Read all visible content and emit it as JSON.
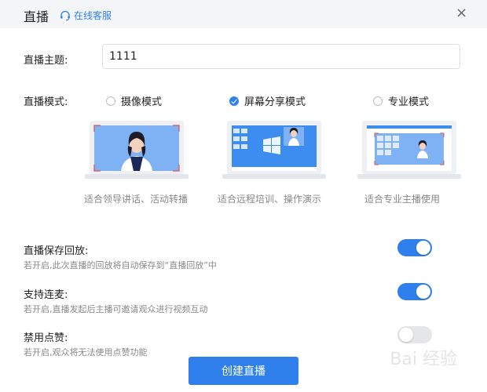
{
  "header": {
    "title": "直播",
    "customer_service": "在线客服",
    "close": "×"
  },
  "topic": {
    "label": "直播主题:",
    "value": "1111"
  },
  "mode": {
    "label": "直播模式:",
    "options": [
      {
        "label": "摄像模式",
        "caption": "适合领导讲话、活动转播",
        "checked": false
      },
      {
        "label": "屏幕分享模式",
        "caption": "适合远程培训、操作演示",
        "checked": true
      },
      {
        "label": "专业模式",
        "caption": "适合专业主播使用",
        "checked": false
      }
    ]
  },
  "settings": [
    {
      "title": "直播保存回放:",
      "desc": "若开启,此次直播的回放将自动保存到“直播回放”中",
      "enabled": true
    },
    {
      "title": "支持连麦:",
      "desc": "若开启,直播发起后主播可邀请观众进行视频互动",
      "enabled": true
    },
    {
      "title": "禁用点赞:",
      "desc": "若开启,观众将无法使用点赞功能",
      "enabled": false
    }
  ],
  "create_button": "创建直播",
  "watermark": "Bai 经验",
  "colors": {
    "accent": "#2f80ed",
    "header_bg": "#f4f5f7",
    "toggle_off": "#e5e6e8"
  }
}
